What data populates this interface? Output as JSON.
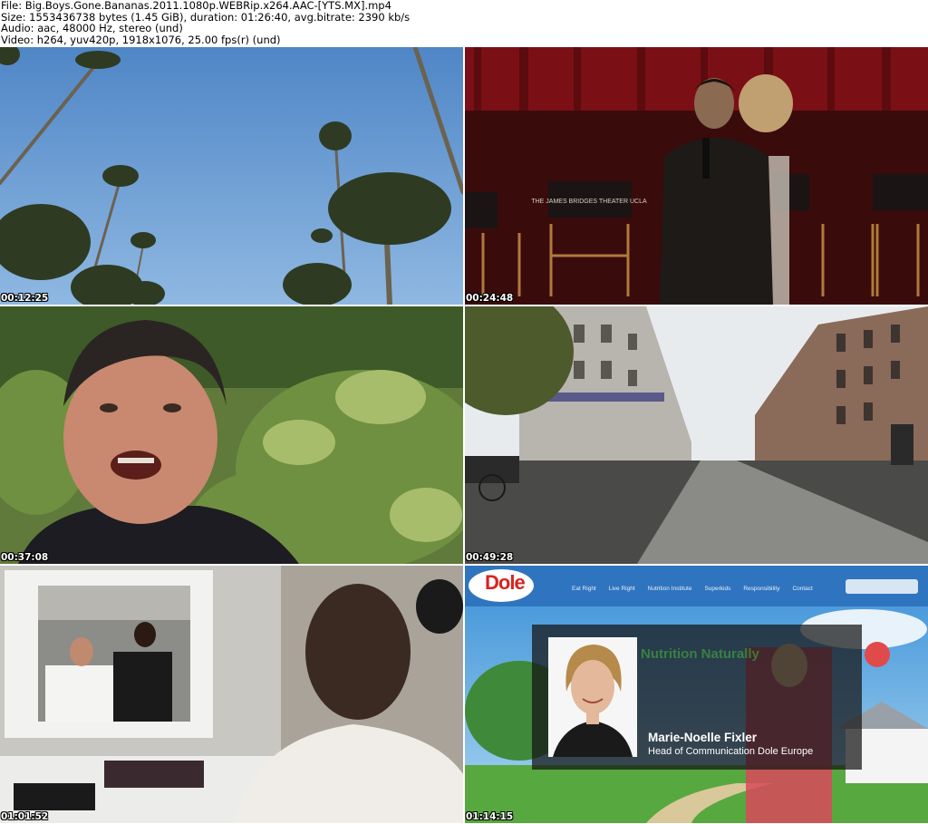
{
  "header": {
    "file_line": "File: Big.Boys.Gone.Bananas.2011.1080p.WEBRip.x264.AAC-[YTS.MX].mp4",
    "size_line": "Size: 1553436738 bytes (1.45 GiB), duration: 01:26:40, avg.bitrate: 2390 kb/s",
    "audio_line": "Audio: aac, 48000 Hz, stereo (und)",
    "video_line": "Video: h264, yuv420p, 1918x1076, 25.00 fps(r) (und)"
  },
  "thumbnails": [
    {
      "timestamp": "00:12:25",
      "scene": "palm-trees"
    },
    {
      "timestamp": "00:24:48",
      "scene": "stage-speaker"
    },
    {
      "timestamp": "00:37:08",
      "scene": "man-talking"
    },
    {
      "timestamp": "00:49:28",
      "scene": "street"
    },
    {
      "timestamp": "01:01:52",
      "scene": "makeup-mirror"
    },
    {
      "timestamp": "01:14:15",
      "scene": "dole-website"
    }
  ],
  "dole": {
    "logo": "Dole",
    "nav": [
      "Eat Right",
      "Live Right",
      "Nutrition Institute",
      "Superkids",
      "Responsibility",
      "Contact"
    ],
    "headline": "Nutrition Naturally",
    "person_name": "Marie-Noelle Fixler",
    "person_title": "Head of Communication Dole Europe"
  },
  "stage": {
    "chair_text": "THE JAMES BRIDGES THEATER UCLA"
  }
}
